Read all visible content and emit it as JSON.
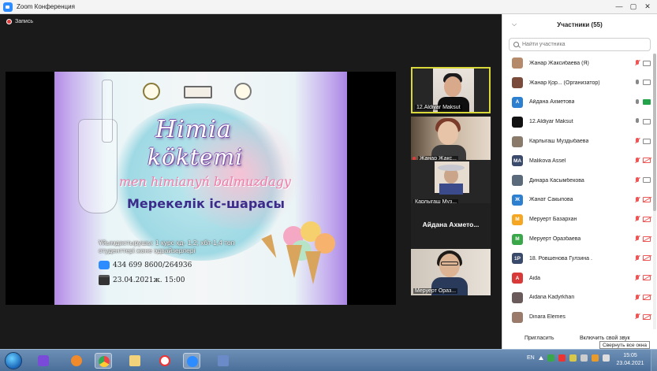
{
  "window": {
    "title": "Zoom Конференция",
    "controls": {
      "minimize": "—",
      "maximize": "▢",
      "close": "✕"
    }
  },
  "recording": {
    "label": "Запись",
    "color": "#e13b3b"
  },
  "shared_content": {
    "title_line1": "Himia",
    "title_line2": "köktemi",
    "title_line3": "men himianyń balmuzdagy",
    "title_line4": "Мерекелік іс-шарасы",
    "organizers": "Ұйымдастырушы: 1 курс хд- 1,2; хбт-1,4 топ студенттері және эдвайзерлері",
    "zoom_id": "434 699 8600/264936",
    "datetime": "23.04.2021ж. 15:00"
  },
  "thumbnails": [
    {
      "name": "12.Aldiyar Maksut",
      "active": true
    },
    {
      "name": "Жанар Жакс...",
      "active": false
    },
    {
      "name": "Карлыгаш Муз...",
      "active": false
    },
    {
      "name": "Айдана Ахмето...",
      "active": false
    },
    {
      "name": "Меруерт Ораз...",
      "active": false
    }
  ],
  "participants_panel": {
    "title": "Участники (55)",
    "collapse_icon": "chevron-down",
    "search_placeholder": "Найти участника",
    "participants": [
      {
        "name": "Жанар Жаксибаева (Я)",
        "avatar": "",
        "avatar_color": "#b48a6a",
        "mic": "muted",
        "cam": "off"
      },
      {
        "name": "Жанар Қор... (Организатор)",
        "avatar": "",
        "avatar_color": "#7a4a3a",
        "mic": "on",
        "cam": "off"
      },
      {
        "name": "Айдана Ахметова",
        "avatar": "A",
        "avatar_color": "#2d7fd0",
        "mic": "on",
        "cam": "on"
      },
      {
        "name": "12.Aldiyar Maksut",
        "avatar": "",
        "avatar_color": "#111111",
        "mic": "on",
        "cam": "off"
      },
      {
        "name": "Карлыгаш Муздыбаева",
        "avatar": "",
        "avatar_color": "#8a7a6a",
        "mic": "muted",
        "cam": "off"
      },
      {
        "name": "Malikova Assel",
        "avatar": "MA",
        "avatar_color": "#3a4a6a",
        "mic": "muted",
        "cam": "muted"
      },
      {
        "name": "Динара Касымбекова",
        "avatar": "",
        "avatar_color": "#5a6a7a",
        "mic": "muted",
        "cam": "off"
      },
      {
        "name": "Жанат Сакыпова",
        "avatar": "Ж",
        "avatar_color": "#2d7fd0",
        "mic": "muted",
        "cam": "muted"
      },
      {
        "name": "Меруерт Базархан",
        "avatar": "M",
        "avatar_color": "#f5a623",
        "mic": "muted",
        "cam": "muted"
      },
      {
        "name": "Меруерт Оразбаева",
        "avatar": "M",
        "avatar_color": "#3aa84a",
        "mic": "muted",
        "cam": "muted"
      },
      {
        "name": "18. Ровшенова Гулзина .",
        "avatar": "1P",
        "avatar_color": "#3a4a6a",
        "mic": "muted",
        "cam": "muted"
      },
      {
        "name": "Aida",
        "avatar": "A",
        "avatar_color": "#d83a3a",
        "mic": "muted",
        "cam": "muted"
      },
      {
        "name": "Aidana Kadyrkhan",
        "avatar": "",
        "avatar_color": "#6a5a5a",
        "mic": "muted",
        "cam": "muted"
      },
      {
        "name": "Dinara Elemes",
        "avatar": "",
        "avatar_color": "#9a7a6a",
        "mic": "muted",
        "cam": "muted"
      }
    ],
    "invite_label": "Пригласить",
    "unmute_label": "Включить свой звук",
    "tooltip": "Свернуть все окна"
  },
  "taskbar": {
    "apps": [
      "start-orb",
      "network-app",
      "media-player",
      "chrome",
      "explorer",
      "yandex-browser",
      "zoom",
      "control-panel"
    ],
    "language": "EN",
    "time": "15:05",
    "date": "23.04.2021"
  }
}
